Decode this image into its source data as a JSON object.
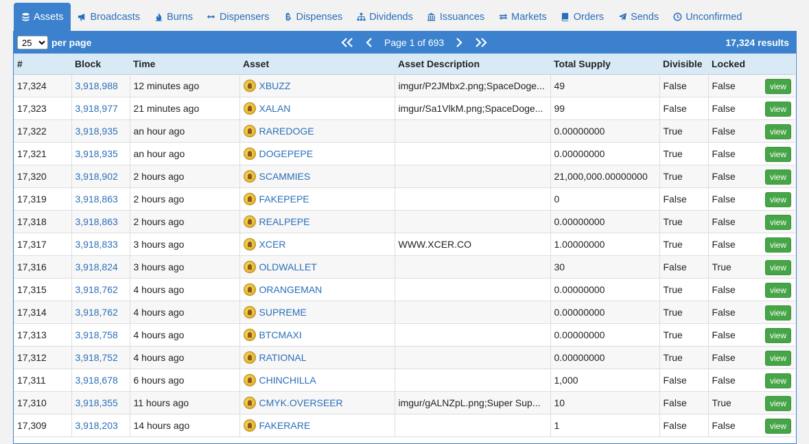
{
  "tabs": [
    {
      "label": "Assets",
      "icon": "database-icon",
      "active": true
    },
    {
      "label": "Broadcasts",
      "icon": "bullhorn-icon"
    },
    {
      "label": "Burns",
      "icon": "fire-icon"
    },
    {
      "label": "Dispensers",
      "icon": "arrows-horizontal-icon"
    },
    {
      "label": "Dispenses",
      "icon": "bitcoin-icon"
    },
    {
      "label": "Dividends",
      "icon": "sitemap-icon"
    },
    {
      "label": "Issuances",
      "icon": "bank-icon"
    },
    {
      "label": "Markets",
      "icon": "exchange-icon"
    },
    {
      "label": "Orders",
      "icon": "book-icon"
    },
    {
      "label": "Sends",
      "icon": "paper-plane-icon"
    },
    {
      "label": "Unconfirmed",
      "icon": "clock-icon"
    }
  ],
  "toolbar": {
    "per_page_value": "25",
    "per_page_label": "per page",
    "page_label": "Page 1 of 693",
    "results_label": "17,324 results"
  },
  "columns": [
    "#",
    "Block",
    "Time",
    "Asset",
    "Asset Description",
    "Total Supply",
    "Divisible",
    "Locked"
  ],
  "view_label": "view",
  "rows": [
    {
      "num": "17,324",
      "block": "3,918,988",
      "time": "12 minutes ago",
      "asset": "XBUZZ",
      "desc": "imgur/P2JMbx2.png;SpaceDoge...",
      "supply": "49",
      "divisible": "False",
      "locked": "False"
    },
    {
      "num": "17,323",
      "block": "3,918,977",
      "time": "21 minutes ago",
      "asset": "XALAN",
      "desc": "imgur/Sa1VlkM.png;SpaceDoge...",
      "supply": "99",
      "divisible": "False",
      "locked": "False"
    },
    {
      "num": "17,322",
      "block": "3,918,935",
      "time": "an hour ago",
      "asset": "RAREDOGE",
      "desc": "",
      "supply": "0.00000000",
      "divisible": "True",
      "locked": "False"
    },
    {
      "num": "17,321",
      "block": "3,918,935",
      "time": "an hour ago",
      "asset": "DOGEPEPE",
      "desc": "",
      "supply": "0.00000000",
      "divisible": "True",
      "locked": "False"
    },
    {
      "num": "17,320",
      "block": "3,918,902",
      "time": "2 hours ago",
      "asset": "SCAMMIES",
      "desc": "",
      "supply": "21,000,000.00000000",
      "divisible": "True",
      "locked": "False"
    },
    {
      "num": "17,319",
      "block": "3,918,863",
      "time": "2 hours ago",
      "asset": "FAKEPEPE",
      "desc": "",
      "supply": "0",
      "divisible": "False",
      "locked": "False"
    },
    {
      "num": "17,318",
      "block": "3,918,863",
      "time": "2 hours ago",
      "asset": "REALPEPE",
      "desc": "",
      "supply": "0.00000000",
      "divisible": "True",
      "locked": "False"
    },
    {
      "num": "17,317",
      "block": "3,918,833",
      "time": "3 hours ago",
      "asset": "XCER",
      "desc": "WWW.XCER.CO",
      "supply": "1.00000000",
      "divisible": "True",
      "locked": "False"
    },
    {
      "num": "17,316",
      "block": "3,918,824",
      "time": "3 hours ago",
      "asset": "OLDWALLET",
      "desc": "",
      "supply": "30",
      "divisible": "False",
      "locked": "True"
    },
    {
      "num": "17,315",
      "block": "3,918,762",
      "time": "4 hours ago",
      "asset": "ORANGEMAN",
      "desc": "",
      "supply": "0.00000000",
      "divisible": "True",
      "locked": "False"
    },
    {
      "num": "17,314",
      "block": "3,918,762",
      "time": "4 hours ago",
      "asset": "SUPREME",
      "desc": "",
      "supply": "0.00000000",
      "divisible": "True",
      "locked": "False"
    },
    {
      "num": "17,313",
      "block": "3,918,758",
      "time": "4 hours ago",
      "asset": "BTCMAXI",
      "desc": "",
      "supply": "0.00000000",
      "divisible": "True",
      "locked": "False"
    },
    {
      "num": "17,312",
      "block": "3,918,752",
      "time": "4 hours ago",
      "asset": "RATIONAL",
      "desc": "",
      "supply": "0.00000000",
      "divisible": "True",
      "locked": "False"
    },
    {
      "num": "17,311",
      "block": "3,918,678",
      "time": "6 hours ago",
      "asset": "CHINCHILLA",
      "desc": "",
      "supply": "1,000",
      "divisible": "False",
      "locked": "False"
    },
    {
      "num": "17,310",
      "block": "3,918,355",
      "time": "11 hours ago",
      "asset": "CMYK.OVERSEER",
      "desc": "imgur/gALNZpL.png;Super Sup...",
      "supply": "10",
      "divisible": "False",
      "locked": "True"
    },
    {
      "num": "17,309",
      "block": "3,918,203",
      "time": "14 hours ago",
      "asset": "FAKERARE",
      "desc": "",
      "supply": "1",
      "divisible": "False",
      "locked": "False"
    }
  ]
}
